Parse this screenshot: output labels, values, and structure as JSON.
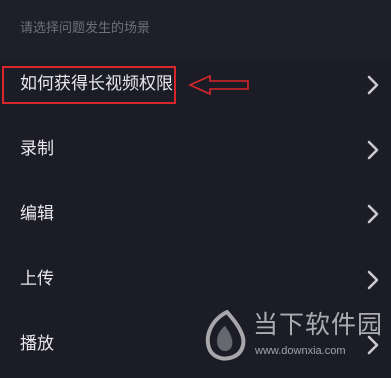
{
  "header": {
    "prompt": "请选择问题发生的场景"
  },
  "menu": {
    "items": [
      {
        "label": "如何获得长视频权限",
        "icon": "chevron-right-icon"
      },
      {
        "label": "录制",
        "icon": "chevron-right-icon"
      },
      {
        "label": "编辑",
        "icon": "chevron-right-icon"
      },
      {
        "label": "上传",
        "icon": "chevron-right-icon"
      },
      {
        "label": "播放",
        "icon": "chevron-right-icon"
      }
    ]
  },
  "annotation": {
    "color": "#d8262a",
    "arrow_icon": "left-arrow-icon"
  },
  "watermark": {
    "name": "当下软件园",
    "url": "www.downxia.com",
    "logo": "downxia-logo"
  },
  "colors": {
    "background": "#1b1c26",
    "text": "#e8e8ec",
    "muted": "#6e6f79",
    "chevron": "#c9c9ce"
  }
}
